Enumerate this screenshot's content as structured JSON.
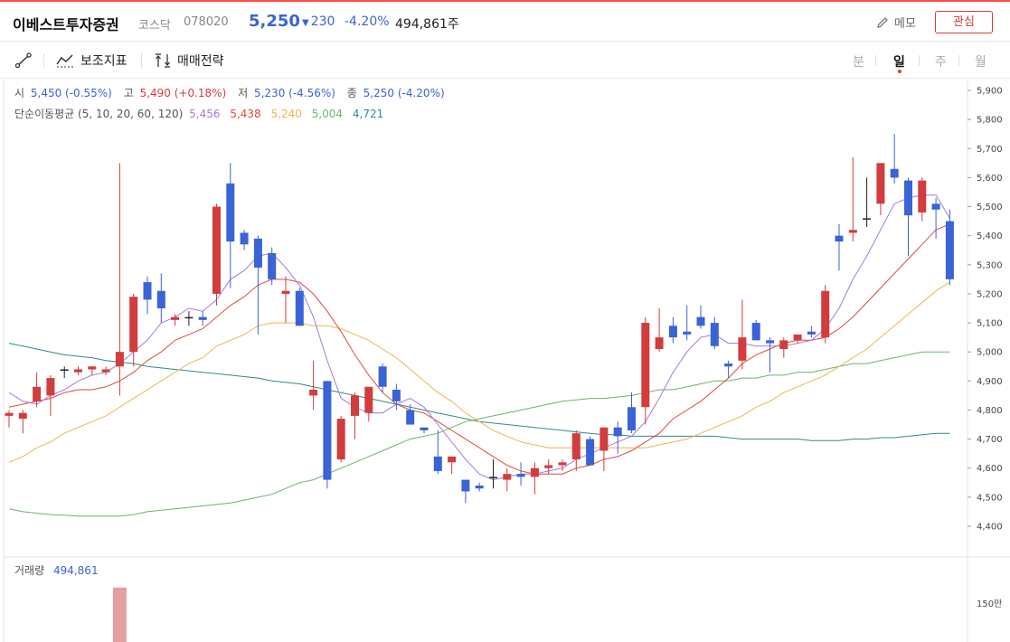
{
  "stock": {
    "name": "이베스트투자증권",
    "market": "코스닥",
    "code": "078020",
    "price": "5,250",
    "change": "230",
    "change_rate": "-4.20%",
    "volume": "494,861주"
  },
  "header_actions": {
    "memo_label": "메모",
    "interest_label": "관심"
  },
  "toolbar": {
    "indicator_label": "보조지표",
    "strategy_label": "매매전략",
    "periods": [
      "분",
      "일",
      "주",
      "월"
    ],
    "active_period": "일"
  },
  "ohlc": {
    "open_label": "시",
    "open_value": "5,450 (-0.55%)",
    "high_label": "고",
    "high_value": "5,490 (+0.18%)",
    "low_label": "저",
    "low_value": "5,230 (-4.56%)",
    "close_label": "종",
    "close_value": "5,250 (-4.20%)"
  },
  "ma": {
    "label": "단순이동평균 (5, 10, 20, 60, 120)",
    "values": [
      "5,456",
      "5,438",
      "5,240",
      "5,004",
      "4,721"
    ]
  },
  "volume_panel": {
    "label": "거래량",
    "value": "494,861",
    "tick": "150만"
  },
  "colors": {
    "up": "#d23c3c",
    "down": "#3a63d6",
    "ma5": "#a479e0",
    "ma10": "#e04a3c",
    "ma20": "#f0b450",
    "ma60": "#6cb56c",
    "ma120": "#2f8a8a"
  },
  "chart_data": {
    "type": "candlestick",
    "y_ticks": [
      "5,900",
      "5,800",
      "5,700",
      "5,600",
      "5,500",
      "5,400",
      "5,300",
      "5,200",
      "5,100",
      "5,000",
      "4,900",
      "4,800",
      "4,700",
      "4,600",
      "4,500",
      "4,400"
    ],
    "ylim": [
      4300,
      5920
    ],
    "candles": [
      [
        4780,
        4800,
        4740,
        4790
      ],
      [
        4770,
        4800,
        4720,
        4790
      ],
      [
        4830,
        4930,
        4810,
        4880
      ],
      [
        4850,
        4920,
        4780,
        4910
      ],
      [
        4940,
        4950,
        4910,
        4940
      ],
      [
        4930,
        4950,
        4920,
        4940
      ],
      [
        4940,
        4950,
        4920,
        4950
      ],
      [
        4930,
        4950,
        4920,
        4940
      ],
      [
        4950,
        5650,
        4850,
        5000
      ],
      [
        5000,
        5200,
        4950,
        5190
      ],
      [
        5240,
        5260,
        5130,
        5180
      ],
      [
        5210,
        5270,
        5100,
        5150
      ],
      [
        5110,
        5130,
        5090,
        5120
      ],
      [
        5120,
        5140,
        5090,
        5120
      ],
      [
        5120,
        5140,
        5090,
        5110
      ],
      [
        5200,
        5510,
        5160,
        5500
      ],
      [
        5580,
        5650,
        5220,
        5380
      ],
      [
        5410,
        5420,
        5350,
        5370
      ],
      [
        5390,
        5400,
        5060,
        5290
      ],
      [
        5340,
        5360,
        5230,
        5250
      ],
      [
        5200,
        5260,
        5100,
        5210
      ],
      [
        5210,
        5220,
        5090,
        5090
      ],
      [
        4850,
        4970,
        4800,
        4870
      ],
      [
        4900,
        4890,
        4530,
        4560
      ],
      [
        4630,
        4780,
        4620,
        4770
      ],
      [
        4780,
        4860,
        4700,
        4850
      ],
      [
        4790,
        4880,
        4760,
        4880
      ],
      [
        4950,
        4960,
        4860,
        4880
      ],
      [
        4870,
        4890,
        4800,
        4830
      ],
      [
        4800,
        4820,
        4760,
        4750
      ],
      [
        4740,
        4740,
        4720,
        4730
      ],
      [
        4640,
        4730,
        4580,
        4590
      ],
      [
        4620,
        4620,
        4580,
        4640
      ],
      [
        4560,
        4560,
        4480,
        4520
      ],
      [
        4540,
        4550,
        4520,
        4530
      ],
      [
        4570,
        4630,
        4530,
        4570
      ],
      [
        4560,
        4600,
        4520,
        4580
      ],
      [
        4580,
        4620,
        4540,
        4570
      ],
      [
        4570,
        4620,
        4510,
        4600
      ],
      [
        4600,
        4630,
        4580,
        4610
      ],
      [
        4610,
        4630,
        4590,
        4620
      ],
      [
        4630,
        4730,
        4590,
        4720
      ],
      [
        4700,
        4710,
        4610,
        4610
      ],
      [
        4660,
        4740,
        4590,
        4740
      ],
      [
        4740,
        4760,
        4650,
        4710
      ],
      [
        4810,
        4860,
        4720,
        4730
      ],
      [
        4810,
        5120,
        4750,
        5100
      ],
      [
        5010,
        5150,
        5000,
        5050
      ],
      [
        5090,
        5120,
        5030,
        5050
      ],
      [
        5070,
        5160,
        5040,
        5060
      ],
      [
        5120,
        5160,
        5080,
        5090
      ],
      [
        5100,
        5120,
        5010,
        5020
      ],
      [
        4960,
        4970,
        4910,
        4950
      ],
      [
        4970,
        5180,
        4940,
        5050
      ],
      [
        5100,
        5110,
        5040,
        5040
      ],
      [
        5040,
        5050,
        4930,
        5030
      ],
      [
        5010,
        5050,
        4980,
        5040
      ],
      [
        5040,
        5060,
        5030,
        5060
      ],
      [
        5070,
        5090,
        5050,
        5060
      ],
      [
        5050,
        5230,
        5030,
        5210
      ],
      [
        5400,
        5440,
        5280,
        5380
      ],
      [
        5410,
        5670,
        5380,
        5420
      ],
      [
        5460,
        5600,
        5430,
        5460
      ],
      [
        5510,
        5620,
        5470,
        5650
      ],
      [
        5630,
        5750,
        5580,
        5600
      ],
      [
        5590,
        5600,
        5330,
        5470
      ],
      [
        5480,
        5600,
        5450,
        5590
      ],
      [
        5510,
        5530,
        5390,
        5490
      ],
      [
        5450,
        5490,
        5230,
        5250
      ]
    ],
    "ma5": [
      4860,
      4830,
      4820,
      4850,
      4870,
      4900,
      4920,
      4930,
      4960,
      5000,
      5040,
      5100,
      5120,
      5150,
      5140,
      5180,
      5250,
      5280,
      5330,
      5340,
      5290,
      5230,
      5120,
      4970,
      4840,
      4810,
      4790,
      4790,
      4820,
      4840,
      4810,
      4750,
      4690,
      4630,
      4580,
      4560,
      4570,
      4580,
      4580,
      4590,
      4600,
      4630,
      4650,
      4670,
      4690,
      4710,
      4760,
      4840,
      4930,
      5000,
      5050,
      5060,
      5030,
      5030,
      5020,
      5020,
      5020,
      5030,
      5040,
      5080,
      5150,
      5250,
      5330,
      5420,
      5510,
      5530,
      5540,
      5540,
      5460
    ],
    "ma10": [
      4810,
      4820,
      4830,
      4840,
      4860,
      4870,
      4870,
      4880,
      4900,
      4930,
      4970,
      5000,
      5040,
      5060,
      5080,
      5120,
      5160,
      5190,
      5230,
      5250,
      5250,
      5240,
      5200,
      5140,
      5070,
      4990,
      4920,
      4860,
      4820,
      4800,
      4790,
      4760,
      4730,
      4700,
      4670,
      4640,
      4610,
      4590,
      4580,
      4580,
      4580,
      4600,
      4610,
      4630,
      4640,
      4660,
      4690,
      4720,
      4770,
      4800,
      4830,
      4870,
      4910,
      4960,
      4990,
      5010,
      5030,
      5040,
      5040,
      5050,
      5080,
      5120,
      5170,
      5220,
      5270,
      5320,
      5370,
      5420,
      5440
    ],
    "ma20": [
      4620,
      4640,
      4670,
      4690,
      4720,
      4740,
      4760,
      4780,
      4810,
      4840,
      4870,
      4900,
      4930,
      4960,
      4980,
      5020,
      5040,
      5060,
      5090,
      5100,
      5100,
      5100,
      5090,
      5090,
      5080,
      5060,
      5040,
      5010,
      4980,
      4940,
      4900,
      4860,
      4830,
      4790,
      4760,
      4730,
      4710,
      4690,
      4680,
      4670,
      4670,
      4670,
      4670,
      4670,
      4670,
      4670,
      4670,
      4680,
      4690,
      4700,
      4720,
      4740,
      4760,
      4780,
      4810,
      4830,
      4860,
      4880,
      4900,
      4920,
      4950,
      4980,
      5010,
      5050,
      5090,
      5130,
      5170,
      5210,
      5240
    ],
    "ma60": [
      4460,
      4450,
      4445,
      4440,
      4438,
      4435,
      4435,
      4435,
      4435,
      4440,
      4450,
      4455,
      4460,
      4465,
      4470,
      4475,
      4480,
      4490,
      4500,
      4510,
      4530,
      4550,
      4560,
      4580,
      4600,
      4620,
      4640,
      4660,
      4680,
      4700,
      4710,
      4720,
      4740,
      4760,
      4770,
      4780,
      4790,
      4800,
      4810,
      4820,
      4830,
      4835,
      4840,
      4840,
      4845,
      4850,
      4860,
      4870,
      4870,
      4880,
      4890,
      4900,
      4900,
      4910,
      4910,
      4920,
      4920,
      4930,
      4930,
      4940,
      4950,
      4960,
      4960,
      4970,
      4980,
      4990,
      5000,
      5000,
      5000
    ],
    "ma120": [
      5030,
      5020,
      5010,
      5000,
      4990,
      4985,
      4980,
      4970,
      4965,
      4960,
      4950,
      4945,
      4940,
      4935,
      4930,
      4925,
      4920,
      4915,
      4910,
      4900,
      4895,
      4890,
      4880,
      4870,
      4860,
      4850,
      4840,
      4830,
      4820,
      4810,
      4800,
      4790,
      4780,
      4770,
      4760,
      4755,
      4750,
      4745,
      4740,
      4735,
      4730,
      4725,
      4720,
      4715,
      4715,
      4710,
      4710,
      4710,
      4710,
      4710,
      4710,
      4710,
      4705,
      4700,
      4700,
      4700,
      4700,
      4700,
      4695,
      4695,
      4695,
      4700,
      4700,
      4705,
      4705,
      4710,
      4715,
      4720,
      4720
    ],
    "volume_ticks": [
      "150만"
    ],
    "volume_visible": [
      0,
      0,
      0,
      0,
      0,
      0,
      0,
      0,
      2100000,
      0,
      0,
      0,
      0,
      0,
      0,
      0,
      0,
      0,
      0,
      0,
      0,
      0,
      0,
      0,
      0,
      0,
      0,
      0,
      0,
      0,
      0,
      0,
      0,
      0,
      0,
      0,
      0,
      0,
      0,
      0,
      0,
      0,
      0,
      0,
      0,
      0,
      0,
      0,
      0,
      0,
      0,
      0,
      0,
      0,
      0,
      0,
      0,
      0,
      0,
      0,
      0,
      0,
      0,
      0,
      0,
      0,
      0,
      0,
      0
    ]
  }
}
